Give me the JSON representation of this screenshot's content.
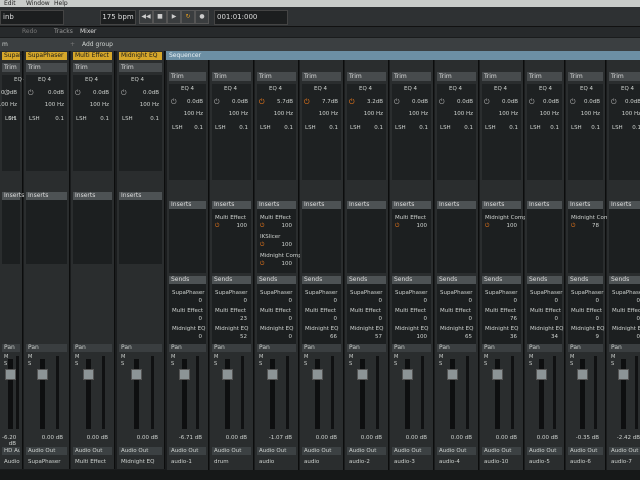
{
  "menu": {
    "items": [
      "Edit",
      "Window",
      "Help"
    ]
  },
  "transport": {
    "tempo": "175 bpm",
    "position": "001:01:000",
    "song_field": "inb"
  },
  "tabs": {
    "items": [
      "Redo",
      "Tracks",
      "Mixer"
    ]
  },
  "groupbar": {
    "left_label": "m",
    "add_group": "Add group"
  },
  "sequencer_label": "Sequencer",
  "strips": [
    {
      "name": "SupaPhaser",
      "yellow": true,
      "gain": "0.0dB",
      "freq": "100 Hz",
      "lsh": "LSH",
      "q": "0.1",
      "ins": [],
      "sends": [],
      "db": "-6.20 dB",
      "out": "HD Audio output",
      "label": "Audio Out"
    },
    {
      "name": "SupaPhaser",
      "yellow": true,
      "gain": "0.0dB",
      "freq": "100 Hz",
      "lsh": "LSH",
      "q": "0.1",
      "ins": [],
      "sends": [],
      "db": "0.00 dB",
      "out": "Audio Out",
      "label": "SupaPhaser"
    },
    {
      "name": "Multi Effect",
      "yellow": true,
      "gain": "0.0dB",
      "freq": "100 Hz",
      "lsh": "LSH",
      "q": "0.1",
      "ins": [],
      "sends": [],
      "db": "0.00 dB",
      "out": "Audio Out",
      "label": "Multi Effect"
    },
    {
      "name": "Midnight EQ",
      "yellow": true,
      "gain": "0.0dB",
      "freq": "100 Hz",
      "lsh": "LSH",
      "q": "0.1",
      "ins": [],
      "sends": [],
      "db": "0.00 dB",
      "out": "Audio Out",
      "label": "Midnight EQ"
    },
    {
      "name": "",
      "yellow": false,
      "gain": "0.0dB",
      "freq": "100 Hz",
      "lsh": "LSH",
      "q": "0.1",
      "ins": [],
      "sends": [
        {
          "n": "SupaPhaser",
          "v": "0"
        },
        {
          "n": "Multi Effect",
          "v": "0"
        },
        {
          "n": "Midnight EQ",
          "v": "0"
        }
      ],
      "db": "-6.71 dB",
      "out": "Audio Out",
      "label": "audio-1"
    },
    {
      "name": "",
      "yellow": false,
      "gain": "0.0dB",
      "freq": "100 Hz",
      "lsh": "LSH",
      "q": "0.1",
      "ins": [
        {
          "n": "Multi Effect",
          "v": "100"
        }
      ],
      "sends": [
        {
          "n": "SupaPhaser",
          "v": "0"
        },
        {
          "n": "Multi Effect",
          "v": "23"
        },
        {
          "n": "Midnight EQ",
          "v": "52"
        }
      ],
      "db": "0.00 dB",
      "out": "Audio Out",
      "label": "drum"
    },
    {
      "name": "",
      "yellow": false,
      "gain": "5.7dB",
      "freq": "100 Hz",
      "lsh": "LSH",
      "q": "0.1",
      "ins": [
        {
          "n": "Multi Effect",
          "v": "100"
        },
        {
          "n": "IKSlicer",
          "v": "100"
        },
        {
          "n": "Midnight Comp",
          "v": "100"
        }
      ],
      "sends": [
        {
          "n": "SupaPhaser",
          "v": "0"
        },
        {
          "n": "Multi Effect",
          "v": "0"
        },
        {
          "n": "Midnight EQ",
          "v": "0"
        }
      ],
      "db": "-1.07 dB",
      "out": "Audio Out",
      "label": "audio"
    },
    {
      "name": "",
      "yellow": false,
      "gain": "7.7dB",
      "freq": "100 Hz",
      "lsh": "LSH",
      "q": "0.1",
      "ins": [],
      "sends": [
        {
          "n": "SupaPhaser",
          "v": "0"
        },
        {
          "n": "Multi Effect",
          "v": "0"
        },
        {
          "n": "Midnight EQ",
          "v": "66"
        }
      ],
      "db": "0.00 dB",
      "out": "Audio Out",
      "label": "audio"
    },
    {
      "name": "",
      "yellow": false,
      "gain": "3.2dB",
      "freq": "100 Hz",
      "lsh": "LSH",
      "q": "0.1",
      "ins": [],
      "sends": [
        {
          "n": "SupaPhaser",
          "v": "0"
        },
        {
          "n": "Multi Effect",
          "v": "0"
        },
        {
          "n": "Midnight EQ",
          "v": "57"
        }
      ],
      "db": "0.00 dB",
      "out": "Audio Out",
      "label": "audio-2"
    },
    {
      "name": "",
      "yellow": false,
      "gain": "0.0dB",
      "freq": "100 Hz",
      "lsh": "LSH",
      "q": "0.1",
      "ins": [
        {
          "n": "Multi Effect",
          "v": "100"
        }
      ],
      "sends": [
        {
          "n": "SupaPhaser",
          "v": "0"
        },
        {
          "n": "Multi Effect",
          "v": "0"
        },
        {
          "n": "Midnight EQ",
          "v": "100"
        }
      ],
      "db": "0.00 dB",
      "out": "Audio Out",
      "label": "audio-3"
    },
    {
      "name": "",
      "yellow": false,
      "gain": "0.0dB",
      "freq": "100 Hz",
      "lsh": "LSH",
      "q": "0.1",
      "ins": [],
      "sends": [
        {
          "n": "SupaPhaser",
          "v": "0"
        },
        {
          "n": "Multi Effect",
          "v": "0"
        },
        {
          "n": "Midnight EQ",
          "v": "65"
        }
      ],
      "db": "0.00 dB",
      "out": "Audio Out",
      "label": "audio-4"
    },
    {
      "name": "",
      "yellow": false,
      "gain": "0.0dB",
      "freq": "100 Hz",
      "lsh": "LSH",
      "q": "0.1",
      "ins": [
        {
          "n": "Midnight Comp",
          "v": "100"
        }
      ],
      "sends": [
        {
          "n": "SupaPhaser",
          "v": "0"
        },
        {
          "n": "Multi Effect",
          "v": "76"
        },
        {
          "n": "Midnight EQ",
          "v": "36"
        }
      ],
      "db": "0.00 dB",
      "out": "Audio Out",
      "label": "audio-10"
    },
    {
      "name": "",
      "yellow": false,
      "gain": "0.0dB",
      "freq": "100 Hz",
      "lsh": "LSH",
      "q": "0.1",
      "ins": [],
      "sends": [
        {
          "n": "SupaPhaser",
          "v": "0"
        },
        {
          "n": "Multi Effect",
          "v": "0"
        },
        {
          "n": "Midnight EQ",
          "v": "34"
        }
      ],
      "db": "0.00 dB",
      "out": "Audio Out",
      "label": "audio-5"
    },
    {
      "name": "",
      "yellow": false,
      "gain": "0.0dB",
      "freq": "100 Hz",
      "lsh": "LSH",
      "q": "0.1",
      "ins": [
        {
          "n": "Midnight Comp",
          "v": "78"
        }
      ],
      "sends": [
        {
          "n": "SupaPhaser",
          "v": "0"
        },
        {
          "n": "Multi Effect",
          "v": "0"
        },
        {
          "n": "Midnight EQ",
          "v": "9"
        }
      ],
      "db": "-0.35 dB",
      "out": "Audio Out",
      "label": "audio-6"
    },
    {
      "name": "",
      "yellow": false,
      "gain": "0.0dB",
      "freq": "100 Hz",
      "lsh": "LSH",
      "q": "0.1",
      "ins": [],
      "sends": [
        {
          "n": "SupaPhaser",
          "v": "0"
        },
        {
          "n": "Multi Effect",
          "v": "0"
        },
        {
          "n": "Midnight EQ",
          "v": "0"
        }
      ],
      "db": "-2.42 dB",
      "out": "Audio Out",
      "label": "audio-7"
    }
  ],
  "labels": {
    "trim": "Trim",
    "eq": "EQ 4",
    "inserts": "Inserts",
    "sends": "Sends",
    "pan": "Pan",
    "mute": "M",
    "solo": "S"
  }
}
